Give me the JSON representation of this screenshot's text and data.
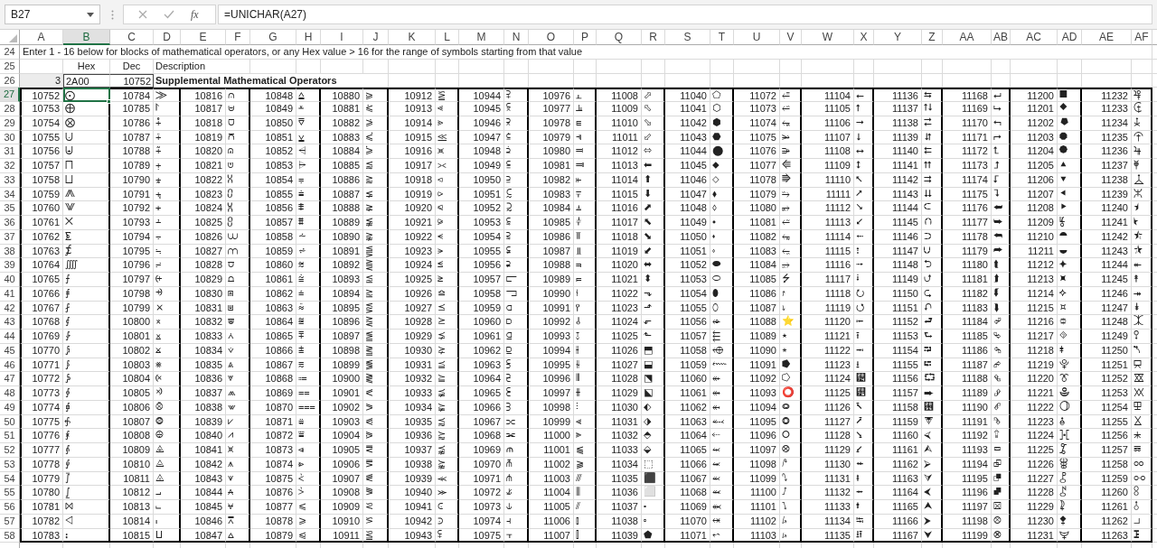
{
  "name_box": "B27",
  "function_label": "fx",
  "formula": "=UNICHAR(A27)",
  "columns": [
    {
      "label": "A",
      "selected": false
    },
    {
      "label": "B",
      "selected": true
    },
    {
      "label": "C",
      "selected": false
    },
    {
      "label": "D",
      "selected": false
    },
    {
      "label": "E",
      "selected": false
    },
    {
      "label": "F",
      "selected": false
    },
    {
      "label": "G",
      "selected": false
    },
    {
      "label": "H",
      "selected": false
    },
    {
      "label": "I",
      "selected": false
    },
    {
      "label": "J",
      "selected": false
    },
    {
      "label": "K",
      "selected": false
    },
    {
      "label": "L",
      "selected": false
    },
    {
      "label": "M",
      "selected": false
    },
    {
      "label": "N",
      "selected": false
    },
    {
      "label": "O",
      "selected": false
    },
    {
      "label": "P",
      "selected": false
    },
    {
      "label": "Q",
      "selected": false
    },
    {
      "label": "R",
      "selected": false
    },
    {
      "label": "S",
      "selected": false
    },
    {
      "label": "T",
      "selected": false
    },
    {
      "label": "U",
      "selected": false
    },
    {
      "label": "V",
      "selected": false
    },
    {
      "label": "W",
      "selected": false
    },
    {
      "label": "X",
      "selected": false
    },
    {
      "label": "Y",
      "selected": false
    },
    {
      "label": "Z",
      "selected": false
    },
    {
      "label": "AA",
      "selected": false
    },
    {
      "label": "AB",
      "selected": false
    },
    {
      "label": "AC",
      "selected": false
    },
    {
      "label": "AD",
      "selected": false
    },
    {
      "label": "AE",
      "selected": false
    },
    {
      "label": "AF",
      "selected": false
    }
  ],
  "instruction_row": {
    "row": "24",
    "text": "Enter 1 - 16 below for blocks of mathematical operators, or any Hex value > 16 for the range of symbols starting from that value"
  },
  "header_row": {
    "row": "25",
    "hex": "Hex",
    "dec": "Dec",
    "description": "Description"
  },
  "block_row": {
    "row": "26",
    "index": "3",
    "hex": "2A00",
    "dec": "10752",
    "description": "Supplemental Mathematical Operators"
  },
  "rows": [
    {
      "row": "27",
      "selected": true,
      "cells": [
        [
          "10752",
          "⨀"
        ],
        [
          "10784",
          "⨠"
        ],
        [
          "10816",
          "⩀"
        ],
        [
          "10848",
          "⩠"
        ],
        [
          "10880",
          "⪀"
        ],
        [
          "10912",
          "⪠"
        ],
        [
          "10944",
          "⫀"
        ],
        [
          "10976",
          "⫠"
        ],
        [
          "11008",
          "⬀"
        ],
        [
          "11040",
          "⬠"
        ],
        [
          "11072",
          "⭀"
        ],
        [
          "11104",
          "⭠"
        ],
        [
          "11136",
          "⮀"
        ],
        [
          "11168",
          "⮠"
        ],
        [
          "11200",
          "⯀"
        ],
        [
          "11232",
          "⯠"
        ]
      ]
    },
    {
      "row": "28",
      "selected": false,
      "cells": [
        [
          "10753",
          "⨁"
        ],
        [
          "10785",
          "⨡"
        ],
        [
          "10817",
          "⩁"
        ],
        [
          "10849",
          "⩡"
        ],
        [
          "10881",
          "⪁"
        ],
        [
          "10913",
          "⪡"
        ],
        [
          "10945",
          "⫁"
        ],
        [
          "10977",
          "⫡"
        ],
        [
          "11009",
          "⬁"
        ],
        [
          "11041",
          "⬡"
        ],
        [
          "11073",
          "⭁"
        ],
        [
          "11105",
          "⭡"
        ],
        [
          "11137",
          "⮁"
        ],
        [
          "11169",
          "⮡"
        ],
        [
          "11201",
          "⯁"
        ],
        [
          "11233",
          "⯡"
        ]
      ]
    },
    {
      "row": "29",
      "selected": false,
      "cells": [
        [
          "10754",
          "⨂"
        ],
        [
          "10786",
          "⨢"
        ],
        [
          "10818",
          "⩂"
        ],
        [
          "10850",
          "⩢"
        ],
        [
          "10882",
          "⪂"
        ],
        [
          "10914",
          "⪢"
        ],
        [
          "10946",
          "⫂"
        ],
        [
          "10978",
          "⫢"
        ],
        [
          "11010",
          "⬂"
        ],
        [
          "11042",
          "⬢"
        ],
        [
          "11074",
          "⭂"
        ],
        [
          "11106",
          "⭢"
        ],
        [
          "11138",
          "⮂"
        ],
        [
          "11170",
          "⮢"
        ],
        [
          "11202",
          "⯂"
        ],
        [
          "11234",
          "⯢"
        ]
      ]
    },
    {
      "row": "30",
      "selected": false,
      "cells": [
        [
          "10755",
          "⨃"
        ],
        [
          "10787",
          "⨣"
        ],
        [
          "10819",
          "⩃"
        ],
        [
          "10851",
          "⩣"
        ],
        [
          "10883",
          "⪃"
        ],
        [
          "10915",
          "⪣"
        ],
        [
          "10947",
          "⫃"
        ],
        [
          "10979",
          "⫣"
        ],
        [
          "11011",
          "⬃"
        ],
        [
          "11043",
          "⬣"
        ],
        [
          "11075",
          "⭃"
        ],
        [
          "11107",
          "⭣"
        ],
        [
          "11139",
          "⮃"
        ],
        [
          "11171",
          "⮣"
        ],
        [
          "11203",
          "⯃"
        ],
        [
          "11235",
          "⯣"
        ]
      ]
    },
    {
      "row": "31",
      "selected": false,
      "cells": [
        [
          "10756",
          "⨄"
        ],
        [
          "10788",
          "⨤"
        ],
        [
          "10820",
          "⩄"
        ],
        [
          "10852",
          "⩤"
        ],
        [
          "10884",
          "⪄"
        ],
        [
          "10916",
          "⪤"
        ],
        [
          "10948",
          "⫄"
        ],
        [
          "10980",
          "⫤"
        ],
        [
          "11012",
          "⬄"
        ],
        [
          "11044",
          "⬤"
        ],
        [
          "11076",
          "⭄"
        ],
        [
          "11108",
          "⭤"
        ],
        [
          "11140",
          "⮄"
        ],
        [
          "11172",
          "⮤"
        ],
        [
          "11204",
          "⯄"
        ],
        [
          "11236",
          "⯤"
        ]
      ]
    },
    {
      "row": "32",
      "selected": false,
      "cells": [
        [
          "10757",
          "⨅"
        ],
        [
          "10789",
          "⨥"
        ],
        [
          "10821",
          "⩅"
        ],
        [
          "10853",
          "⩥"
        ],
        [
          "10885",
          "⪅"
        ],
        [
          "10917",
          "⪥"
        ],
        [
          "10949",
          "⫅"
        ],
        [
          "10981",
          "⫥"
        ],
        [
          "11013",
          "⬅"
        ],
        [
          "11045",
          "⬥"
        ],
        [
          "11077",
          "⭅"
        ],
        [
          "11109",
          "⭥"
        ],
        [
          "11141",
          "⮅"
        ],
        [
          "11173",
          "⮥"
        ],
        [
          "11205",
          "⯅"
        ],
        [
          "11237",
          "⯥"
        ]
      ]
    },
    {
      "row": "33",
      "selected": false,
      "cells": [
        [
          "10758",
          "⨆"
        ],
        [
          "10790",
          "⨦"
        ],
        [
          "10822",
          "⩆"
        ],
        [
          "10854",
          "⩦"
        ],
        [
          "10886",
          "⪆"
        ],
        [
          "10918",
          "⪦"
        ],
        [
          "10950",
          "⫆"
        ],
        [
          "10982",
          "⫦"
        ],
        [
          "11014",
          "⬆"
        ],
        [
          "11046",
          "⬦"
        ],
        [
          "11078",
          "⭆"
        ],
        [
          "11110",
          "⭦"
        ],
        [
          "11142",
          "⮆"
        ],
        [
          "11174",
          "⮦"
        ],
        [
          "11206",
          "⯆"
        ],
        [
          "11238",
          "⯦"
        ]
      ]
    },
    {
      "row": "34",
      "selected": false,
      "cells": [
        [
          "10759",
          "⨇"
        ],
        [
          "10791",
          "⨧"
        ],
        [
          "10823",
          "⩇"
        ],
        [
          "10855",
          "⩧"
        ],
        [
          "10887",
          "⪇"
        ],
        [
          "10919",
          "⪧"
        ],
        [
          "10951",
          "⫇"
        ],
        [
          "10983",
          "⫧"
        ],
        [
          "11015",
          "⬇"
        ],
        [
          "11047",
          "⬧"
        ],
        [
          "11079",
          "⭇"
        ],
        [
          "11111",
          "⭧"
        ],
        [
          "11143",
          "⮇"
        ],
        [
          "11175",
          "⮧"
        ],
        [
          "11207",
          "⯇"
        ],
        [
          "11239",
          "⯧"
        ]
      ]
    },
    {
      "row": "35",
      "selected": false,
      "cells": [
        [
          "10760",
          "⨈"
        ],
        [
          "10792",
          "⨨"
        ],
        [
          "10824",
          "⩈"
        ],
        [
          "10856",
          "⩨"
        ],
        [
          "10888",
          "⪈"
        ],
        [
          "10920",
          "⪨"
        ],
        [
          "10952",
          "⫈"
        ],
        [
          "10984",
          "⫨"
        ],
        [
          "11016",
          "⬈"
        ],
        [
          "11048",
          "⬨"
        ],
        [
          "11080",
          "⭈"
        ],
        [
          "11112",
          "⭨"
        ],
        [
          "11144",
          "⮈"
        ],
        [
          "11176",
          "⮨"
        ],
        [
          "11208",
          "⯈"
        ],
        [
          "11240",
          "⯨"
        ]
      ]
    },
    {
      "row": "36",
      "selected": false,
      "cells": [
        [
          "10761",
          "⨉"
        ],
        [
          "10793",
          "⨩"
        ],
        [
          "10825",
          "⩉"
        ],
        [
          "10857",
          "⩩"
        ],
        [
          "10889",
          "⪉"
        ],
        [
          "10921",
          "⪩"
        ],
        [
          "10953",
          "⫉"
        ],
        [
          "10985",
          "⫩"
        ],
        [
          "11017",
          "⬉"
        ],
        [
          "11049",
          "⬩"
        ],
        [
          "11081",
          "⭉"
        ],
        [
          "11113",
          "⭩"
        ],
        [
          "11145",
          "⮉"
        ],
        [
          "11177",
          "⮩"
        ],
        [
          "11209",
          "⯉"
        ],
        [
          "11241",
          "⯩"
        ]
      ]
    },
    {
      "row": "37",
      "selected": false,
      "cells": [
        [
          "10762",
          "⨊"
        ],
        [
          "10794",
          "⨪"
        ],
        [
          "10826",
          "⩊"
        ],
        [
          "10858",
          "⩪"
        ],
        [
          "10890",
          "⪊"
        ],
        [
          "10922",
          "⪪"
        ],
        [
          "10954",
          "⫊"
        ],
        [
          "10986",
          "⫪"
        ],
        [
          "11018",
          "⬊"
        ],
        [
          "11050",
          "⬪"
        ],
        [
          "11082",
          "⭊"
        ],
        [
          "11114",
          "⭪"
        ],
        [
          "11146",
          "⮊"
        ],
        [
          "11178",
          "⮪"
        ],
        [
          "11210",
          "⯊"
        ],
        [
          "11242",
          "⯪"
        ]
      ]
    },
    {
      "row": "38",
      "selected": false,
      "cells": [
        [
          "10763",
          "⨋"
        ],
        [
          "10795",
          "⨫"
        ],
        [
          "10827",
          "⩋"
        ],
        [
          "10859",
          "⩫"
        ],
        [
          "10891",
          "⪋"
        ],
        [
          "10923",
          "⪫"
        ],
        [
          "10955",
          "⫋"
        ],
        [
          "10987",
          "⫫"
        ],
        [
          "11019",
          "⬋"
        ],
        [
          "11051",
          "⬫"
        ],
        [
          "11083",
          "⭋"
        ],
        [
          "11115",
          "⭫"
        ],
        [
          "11147",
          "⮋"
        ],
        [
          "11179",
          "⮫"
        ],
        [
          "11211",
          "⯋"
        ],
        [
          "11243",
          "⯫"
        ]
      ]
    },
    {
      "row": "39",
      "selected": false,
      "cells": [
        [
          "10764",
          "⨌"
        ],
        [
          "10796",
          "⨬"
        ],
        [
          "10828",
          "⩌"
        ],
        [
          "10860",
          "⩬"
        ],
        [
          "10892",
          "⪌"
        ],
        [
          "10924",
          "⪬"
        ],
        [
          "10956",
          "⫌"
        ],
        [
          "10988",
          "⫬"
        ],
        [
          "11020",
          "⬌"
        ],
        [
          "11052",
          "⬬"
        ],
        [
          "11084",
          "⭌"
        ],
        [
          "11116",
          "⭬"
        ],
        [
          "11148",
          "⮌"
        ],
        [
          "11180",
          "⮬"
        ],
        [
          "11212",
          "⯌"
        ],
        [
          "11244",
          "⯬"
        ]
      ]
    },
    {
      "row": "40",
      "selected": false,
      "cells": [
        [
          "10765",
          "⨍"
        ],
        [
          "10797",
          "⨭"
        ],
        [
          "10829",
          "⩍"
        ],
        [
          "10861",
          "⩭"
        ],
        [
          "10893",
          "⪍"
        ],
        [
          "10925",
          "⪭"
        ],
        [
          "10957",
          "⫍"
        ],
        [
          "10989",
          "⫭"
        ],
        [
          "11021",
          "⬍"
        ],
        [
          "11053",
          "⬭"
        ],
        [
          "11085",
          "⭍"
        ],
        [
          "11117",
          "⭭"
        ],
        [
          "11149",
          "⮍"
        ],
        [
          "11181",
          "⮭"
        ],
        [
          "11213",
          "⯍"
        ],
        [
          "11245",
          "⯭"
        ]
      ]
    },
    {
      "row": "41",
      "selected": false,
      "cells": [
        [
          "10766",
          "⨎"
        ],
        [
          "10798",
          "⨮"
        ],
        [
          "10830",
          "⩎"
        ],
        [
          "10862",
          "⩮"
        ],
        [
          "10894",
          "⪎"
        ],
        [
          "10926",
          "⪮"
        ],
        [
          "10958",
          "⫎"
        ],
        [
          "10990",
          "⫮"
        ],
        [
          "11022",
          "⬎"
        ],
        [
          "11054",
          "⬮"
        ],
        [
          "11086",
          "⭎"
        ],
        [
          "11118",
          "⭮"
        ],
        [
          "11150",
          "⮎"
        ],
        [
          "11182",
          "⮮"
        ],
        [
          "11214",
          "⯎"
        ],
        [
          "11246",
          "⯮"
        ]
      ]
    },
    {
      "row": "42",
      "selected": false,
      "cells": [
        [
          "10767",
          "⨏"
        ],
        [
          "10799",
          "⨯"
        ],
        [
          "10831",
          "⩏"
        ],
        [
          "10863",
          "⩯"
        ],
        [
          "10895",
          "⪏"
        ],
        [
          "10927",
          "⪯"
        ],
        [
          "10959",
          "⫏"
        ],
        [
          "10991",
          "⫯"
        ],
        [
          "11023",
          "⬏"
        ],
        [
          "11055",
          "⬯"
        ],
        [
          "11087",
          "⭏"
        ],
        [
          "11119",
          "⭯"
        ],
        [
          "11151",
          "⮏"
        ],
        [
          "11183",
          "⮯"
        ],
        [
          "11215",
          "⯏"
        ],
        [
          "11247",
          "⯯"
        ]
      ]
    },
    {
      "row": "43",
      "selected": false,
      "cells": [
        [
          "10768",
          "⨐"
        ],
        [
          "10800",
          "⨰"
        ],
        [
          "10832",
          "⩐"
        ],
        [
          "10864",
          "⩰"
        ],
        [
          "10896",
          "⪐"
        ],
        [
          "10928",
          "⪰"
        ],
        [
          "10960",
          "⫐"
        ],
        [
          "10992",
          "⫰"
        ],
        [
          "11024",
          "⬐"
        ],
        [
          "11056",
          "⬰"
        ],
        [
          "11088",
          "⭐"
        ],
        [
          "11120",
          "⭰"
        ],
        [
          "11152",
          "⮐"
        ],
        [
          "11184",
          "⮰"
        ],
        [
          "11216",
          "⯐"
        ],
        [
          "11248",
          "⯰"
        ]
      ]
    },
    {
      "row": "44",
      "selected": false,
      "cells": [
        [
          "10769",
          "⨑"
        ],
        [
          "10801",
          "⨱"
        ],
        [
          "10833",
          "⩑"
        ],
        [
          "10865",
          "⩱"
        ],
        [
          "10897",
          "⪑"
        ],
        [
          "10929",
          "⪱"
        ],
        [
          "10961",
          "⫑"
        ],
        [
          "10993",
          "⫱"
        ],
        [
          "11025",
          "⬑"
        ],
        [
          "11057",
          "⬱"
        ],
        [
          "11089",
          "⭑"
        ],
        [
          "11121",
          "⭱"
        ],
        [
          "11153",
          "⮑"
        ],
        [
          "11185",
          "⮱"
        ],
        [
          "11217",
          "⯑"
        ],
        [
          "11249",
          "⯱"
        ]
      ]
    },
    {
      "row": "45",
      "selected": false,
      "cells": [
        [
          "10770",
          "⨒"
        ],
        [
          "10802",
          "⨲"
        ],
        [
          "10834",
          "⩒"
        ],
        [
          "10866",
          "⩲"
        ],
        [
          "10898",
          "⪒"
        ],
        [
          "10930",
          "⪲"
        ],
        [
          "10962",
          "⫒"
        ],
        [
          "10994",
          "⫲"
        ],
        [
          "11026",
          "⬒"
        ],
        [
          "11058",
          "⬲"
        ],
        [
          "11090",
          "⭒"
        ],
        [
          "11122",
          "⭲"
        ],
        [
          "11154",
          "⮒"
        ],
        [
          "11186",
          "⮲"
        ],
        [
          "11218",
          "⯒"
        ],
        [
          "11250",
          "⯲"
        ]
      ]
    },
    {
      "row": "46",
      "selected": false,
      "cells": [
        [
          "10771",
          "⨓"
        ],
        [
          "10803",
          "⨳"
        ],
        [
          "10835",
          "⩓"
        ],
        [
          "10867",
          "⩳"
        ],
        [
          "10899",
          "⪓"
        ],
        [
          "10931",
          "⪳"
        ],
        [
          "10963",
          "⫓"
        ],
        [
          "10995",
          "⫳"
        ],
        [
          "11027",
          "⬓"
        ],
        [
          "11059",
          "⬳"
        ],
        [
          "11091",
          "⭓"
        ],
        [
          "11123",
          "⭳"
        ],
        [
          "11155",
          "⮓"
        ],
        [
          "11187",
          "⮳"
        ],
        [
          "11219",
          "⯓"
        ],
        [
          "11251",
          "⯳"
        ]
      ]
    },
    {
      "row": "47",
      "selected": false,
      "cells": [
        [
          "10772",
          "⨔"
        ],
        [
          "10804",
          "⨴"
        ],
        [
          "10836",
          "⩔"
        ],
        [
          "10868",
          "⩴"
        ],
        [
          "10900",
          "⪔"
        ],
        [
          "10932",
          "⪴"
        ],
        [
          "10964",
          "⫔"
        ],
        [
          "10996",
          "⫴"
        ],
        [
          "11028",
          "⬔"
        ],
        [
          "11060",
          "⬴"
        ],
        [
          "11092",
          "⭔"
        ],
        [
          "11124",
          "⭴"
        ],
        [
          "11156",
          "⮔"
        ],
        [
          "11188",
          "⮴"
        ],
        [
          "11220",
          "⯔"
        ],
        [
          "11252",
          "⯴"
        ]
      ]
    },
    {
      "row": "48",
      "selected": false,
      "cells": [
        [
          "10773",
          "⨕"
        ],
        [
          "10805",
          "⨵"
        ],
        [
          "10837",
          "⩕"
        ],
        [
          "10869",
          "⩵"
        ],
        [
          "10901",
          "⪕"
        ],
        [
          "10933",
          "⪵"
        ],
        [
          "10965",
          "⫕"
        ],
        [
          "10997",
          "⫵"
        ],
        [
          "11029",
          "⬕"
        ],
        [
          "11061",
          "⬵"
        ],
        [
          "11093",
          "⭕"
        ],
        [
          "11125",
          "⭵"
        ],
        [
          "11157",
          "⮕"
        ],
        [
          "11189",
          "⮵"
        ],
        [
          "11221",
          "⯕"
        ],
        [
          "11253",
          "⯵"
        ]
      ]
    },
    {
      "row": "49",
      "selected": false,
      "cells": [
        [
          "10774",
          "⨖"
        ],
        [
          "10806",
          "⨶"
        ],
        [
          "10838",
          "⩖"
        ],
        [
          "10870",
          "⩶"
        ],
        [
          "10902",
          "⪖"
        ],
        [
          "10934",
          "⪶"
        ],
        [
          "10966",
          "⫖"
        ],
        [
          "10998",
          "⫶"
        ],
        [
          "11030",
          "⬖"
        ],
        [
          "11062",
          "⬶"
        ],
        [
          "11094",
          "⭖"
        ],
        [
          "11126",
          "⭶"
        ],
        [
          "11158",
          "⮖"
        ],
        [
          "11190",
          "⮶"
        ],
        [
          "11222",
          "⯖"
        ],
        [
          "11254",
          "⯶"
        ]
      ]
    },
    {
      "row": "50",
      "selected": false,
      "cells": [
        [
          "10775",
          "⨗"
        ],
        [
          "10807",
          "⨷"
        ],
        [
          "10839",
          "⩗"
        ],
        [
          "10871",
          "⩷"
        ],
        [
          "10903",
          "⪗"
        ],
        [
          "10935",
          "⪷"
        ],
        [
          "10967",
          "⫗"
        ],
        [
          "10999",
          "⫷"
        ],
        [
          "11031",
          "⬗"
        ],
        [
          "11063",
          "⬷"
        ],
        [
          "11095",
          "⭗"
        ],
        [
          "11127",
          "⭷"
        ],
        [
          "11159",
          "⮗"
        ],
        [
          "11191",
          "⮷"
        ],
        [
          "11223",
          "⯗"
        ],
        [
          "11255",
          "⯷"
        ]
      ]
    },
    {
      "row": "51",
      "selected": false,
      "cells": [
        [
          "10776",
          "⨘"
        ],
        [
          "10808",
          "⨸"
        ],
        [
          "10840",
          "⩘"
        ],
        [
          "10872",
          "⩸"
        ],
        [
          "10904",
          "⪘"
        ],
        [
          "10936",
          "⪸"
        ],
        [
          "10968",
          "⫘"
        ],
        [
          "11000",
          "⫸"
        ],
        [
          "11032",
          "⬘"
        ],
        [
          "11064",
          "⬸"
        ],
        [
          "11096",
          "⭘"
        ],
        [
          "11128",
          "⭸"
        ],
        [
          "11160",
          "⮘"
        ],
        [
          "11192",
          "⮸"
        ],
        [
          "11224",
          "⯘"
        ],
        [
          "11256",
          "⯸"
        ]
      ]
    },
    {
      "row": "52",
      "selected": false,
      "cells": [
        [
          "10777",
          "⨙"
        ],
        [
          "10809",
          "⨹"
        ],
        [
          "10841",
          "⩙"
        ],
        [
          "10873",
          "⩹"
        ],
        [
          "10905",
          "⪙"
        ],
        [
          "10937",
          "⪹"
        ],
        [
          "10969",
          "⫙"
        ],
        [
          "11001",
          "⫹"
        ],
        [
          "11033",
          "⬙"
        ],
        [
          "11065",
          "⬹"
        ],
        [
          "11097",
          "⭙"
        ],
        [
          "11129",
          "⭹"
        ],
        [
          "11161",
          "⮙"
        ],
        [
          "11193",
          "⮹"
        ],
        [
          "11225",
          "⯙"
        ],
        [
          "11257",
          "⯹"
        ]
      ]
    },
    {
      "row": "53",
      "selected": false,
      "cells": [
        [
          "10778",
          "⨚"
        ],
        [
          "10810",
          "⨺"
        ],
        [
          "10842",
          "⩚"
        ],
        [
          "10874",
          "⩺"
        ],
        [
          "10906",
          "⪚"
        ],
        [
          "10938",
          "⪺"
        ],
        [
          "10970",
          "⫚"
        ],
        [
          "11002",
          "⫺"
        ],
        [
          "11034",
          "⬚"
        ],
        [
          "11066",
          "⬺"
        ],
        [
          "11098",
          "⭚"
        ],
        [
          "11130",
          "⭺"
        ],
        [
          "11162",
          "⮚"
        ],
        [
          "11194",
          "⮺"
        ],
        [
          "11226",
          "⯚"
        ],
        [
          "11258",
          "⯺"
        ]
      ]
    },
    {
      "row": "54",
      "selected": false,
      "cells": [
        [
          "10779",
          "⨛"
        ],
        [
          "10811",
          "⨻"
        ],
        [
          "10843",
          "⩛"
        ],
        [
          "10875",
          "⩻"
        ],
        [
          "10907",
          "⪛"
        ],
        [
          "10939",
          "⪻"
        ],
        [
          "10971",
          "⫛"
        ],
        [
          "11003",
          "⫻"
        ],
        [
          "11035",
          "⬛"
        ],
        [
          "11067",
          "⬻"
        ],
        [
          "11099",
          "⭛"
        ],
        [
          "11131",
          "⭻"
        ],
        [
          "11163",
          "⮛"
        ],
        [
          "11195",
          "⮻"
        ],
        [
          "11227",
          "⯛"
        ],
        [
          "11259",
          "⯻"
        ]
      ]
    },
    {
      "row": "55",
      "selected": false,
      "cells": [
        [
          "10780",
          "⨜"
        ],
        [
          "10812",
          "⨼"
        ],
        [
          "10844",
          "⩜"
        ],
        [
          "10876",
          "⩼"
        ],
        [
          "10908",
          "⪜"
        ],
        [
          "10940",
          "⪼"
        ],
        [
          "10972",
          "⫝̸"
        ],
        [
          "11004",
          "⫼"
        ],
        [
          "11036",
          "⬜"
        ],
        [
          "11068",
          "⬼"
        ],
        [
          "11100",
          "⭜"
        ],
        [
          "11132",
          "⭼"
        ],
        [
          "11164",
          "⮜"
        ],
        [
          "11196",
          "⮼"
        ],
        [
          "11228",
          "⯜"
        ],
        [
          "11260",
          "⯼"
        ]
      ]
    },
    {
      "row": "56",
      "selected": false,
      "cells": [
        [
          "10781",
          "⨝"
        ],
        [
          "10813",
          "⨽"
        ],
        [
          "10845",
          "⩝"
        ],
        [
          "10877",
          "⩽"
        ],
        [
          "10909",
          "⪝"
        ],
        [
          "10941",
          "⪽"
        ],
        [
          "10973",
          "⫝"
        ],
        [
          "11005",
          "⫽"
        ],
        [
          "11037",
          "⬝"
        ],
        [
          "11069",
          "⬽"
        ],
        [
          "11101",
          "⭝"
        ],
        [
          "11133",
          "⭽"
        ],
        [
          "11165",
          "⮝"
        ],
        [
          "11197",
          "⮽"
        ],
        [
          "11229",
          "⯝"
        ],
        [
          "11261",
          "⯽"
        ]
      ]
    },
    {
      "row": "57",
      "selected": false,
      "cells": [
        [
          "10782",
          "⨞"
        ],
        [
          "10814",
          "⨾"
        ],
        [
          "10846",
          "⩞"
        ],
        [
          "10878",
          "⩾"
        ],
        [
          "10910",
          "⪞"
        ],
        [
          "10942",
          "⪾"
        ],
        [
          "10974",
          "⫞"
        ],
        [
          "11006",
          "⫾"
        ],
        [
          "11038",
          "⬞"
        ],
        [
          "11070",
          "⬾"
        ],
        [
          "11102",
          "⭞"
        ],
        [
          "11134",
          "⭾"
        ],
        [
          "11166",
          "⮞"
        ],
        [
          "11198",
          "⮾"
        ],
        [
          "11230",
          "⯞"
        ],
        [
          "11262",
          "⯾"
        ]
      ]
    },
    {
      "row": "58",
      "selected": false,
      "cells": [
        [
          "10783",
          "⨟"
        ],
        [
          "10815",
          "⨿"
        ],
        [
          "10847",
          "⩟"
        ],
        [
          "10879",
          "⩿"
        ],
        [
          "10911",
          "⪟"
        ],
        [
          "10943",
          "⪿"
        ],
        [
          "10975",
          "⫟"
        ],
        [
          "11007",
          "⫿"
        ],
        [
          "11039",
          "⬟"
        ],
        [
          "11071",
          "⬿"
        ],
        [
          "11103",
          "⭟"
        ],
        [
          "11135",
          "⭿"
        ],
        [
          "11167",
          "⮟"
        ],
        [
          "11199",
          "⮿"
        ],
        [
          "11231",
          "⯟"
        ],
        [
          "11263",
          "⯿"
        ]
      ]
    }
  ]
}
